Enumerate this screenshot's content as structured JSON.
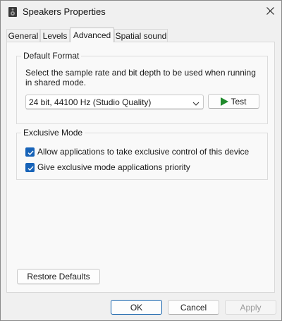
{
  "window": {
    "title": "Speakers Properties",
    "close_icon": "close-icon",
    "app_icon": "speaker-icon"
  },
  "tabs": [
    {
      "label": "General",
      "active": false
    },
    {
      "label": "Levels",
      "active": false
    },
    {
      "label": "Advanced",
      "active": true
    },
    {
      "label": "Spatial sound",
      "active": false
    }
  ],
  "default_format": {
    "group_label": "Default Format",
    "description": "Select the sample rate and bit depth to be used when running in shared mode.",
    "selected_format": "24 bit, 44100 Hz (Studio Quality)",
    "test_label": "Test",
    "test_icon": "play-icon"
  },
  "exclusive_mode": {
    "group_label": "Exclusive Mode",
    "options": [
      {
        "label": "Allow applications to take exclusive control of this device",
        "checked": true
      },
      {
        "label": "Give exclusive mode applications priority",
        "checked": true
      }
    ]
  },
  "restore_defaults_label": "Restore Defaults",
  "footer": {
    "ok_label": "OK",
    "cancel_label": "Cancel",
    "apply_label": "Apply",
    "apply_enabled": false
  },
  "colors": {
    "accent": "#1763b8",
    "play_green": "#1f8a2b"
  }
}
